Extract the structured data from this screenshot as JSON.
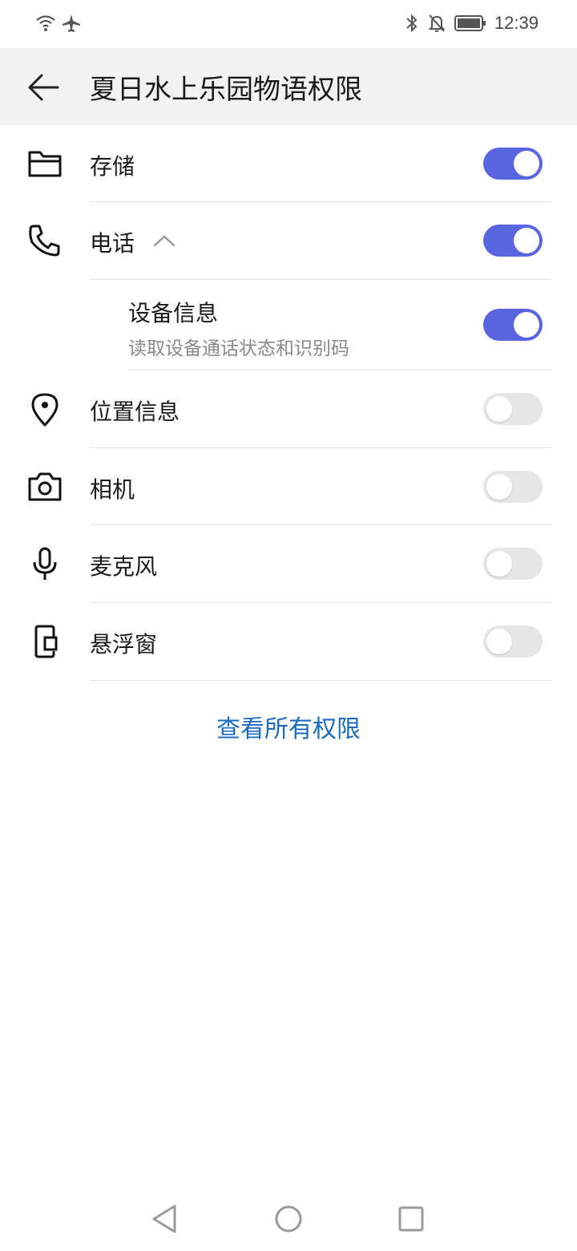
{
  "status_bar": {
    "time": "12:39",
    "left_icons": [
      "wifi-icon",
      "airplane-icon"
    ],
    "right_icons": [
      "bluetooth-icon",
      "mute-notification-icon",
      "battery-icon"
    ]
  },
  "header": {
    "back_icon": "back-arrow-icon",
    "title": "夏日水上乐园物语权限"
  },
  "permissions": [
    {
      "id": "storage",
      "icon": "folder-icon",
      "label": "存储",
      "enabled": true
    },
    {
      "id": "phone",
      "icon": "phone-icon",
      "label": "电话",
      "enabled": true,
      "expanded": true,
      "children": [
        {
          "id": "device-info",
          "label": "设备信息",
          "description": "读取设备通话状态和识别码",
          "enabled": true
        }
      ]
    },
    {
      "id": "location",
      "icon": "location-pin-icon",
      "label": "位置信息",
      "enabled": false
    },
    {
      "id": "camera",
      "icon": "camera-icon",
      "label": "相机",
      "enabled": false
    },
    {
      "id": "microphone",
      "icon": "microphone-icon",
      "label": "麦克风",
      "enabled": false
    },
    {
      "id": "floating-window",
      "icon": "floating-window-icon",
      "label": "悬浮窗",
      "enabled": false
    }
  ],
  "footer": {
    "view_all_label": "查看所有权限"
  },
  "nav_bar": {
    "items": [
      "back-triangle-icon",
      "home-circle-icon",
      "recents-square-icon"
    ]
  },
  "colors": {
    "accent": "#5864e0",
    "link": "#1a6bbf",
    "header_bg": "#f2f2f2"
  }
}
